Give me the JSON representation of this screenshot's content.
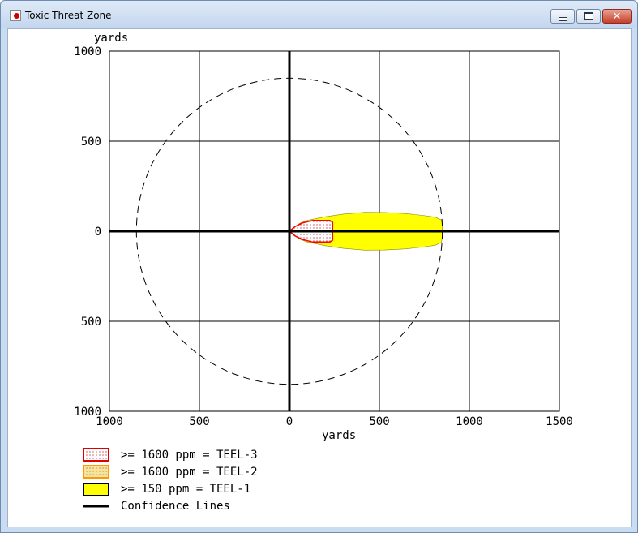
{
  "window": {
    "title": "Toxic Threat Zone",
    "icon": "toxic-zone-app-icon",
    "controls": {
      "minimize_icon": "minimize-icon",
      "maximize_icon": "maximize-icon",
      "close_icon": "close-icon",
      "close_glyph": "✕"
    }
  },
  "chart_data": {
    "type": "threat-zone plot",
    "x": {
      "label": "yards",
      "range": [
        -1000,
        1500
      ],
      "ticks": [
        1000,
        500,
        0,
        500,
        1000,
        1500
      ],
      "tick_values": [
        -1000,
        -500,
        0,
        500,
        1000,
        1500
      ]
    },
    "y": {
      "label": "yards",
      "range": [
        -1000,
        1000
      ],
      "ticks": [
        1000,
        500,
        0,
        500,
        1000
      ],
      "tick_values": [
        1000,
        500,
        0,
        -500,
        -1000
      ]
    },
    "grid": true,
    "confidence_circle_radius": 850,
    "zones": [
      {
        "name": "TEEL-1",
        "color": "#ffff00",
        "outline": [
          [
            0,
            0
          ],
          [
            20,
            -20
          ],
          [
            60,
            -45
          ],
          [
            100,
            -60
          ],
          [
            200,
            -80
          ],
          [
            300,
            -95
          ],
          [
            420,
            -105
          ],
          [
            530,
            -104
          ],
          [
            640,
            -98
          ],
          [
            740,
            -88
          ],
          [
            810,
            -78
          ],
          [
            845,
            -62
          ],
          [
            850,
            -25
          ],
          [
            850,
            25
          ],
          [
            845,
            62
          ],
          [
            810,
            78
          ],
          [
            740,
            88
          ],
          [
            640,
            98
          ],
          [
            530,
            104
          ],
          [
            420,
            105
          ],
          [
            300,
            95
          ],
          [
            200,
            80
          ],
          [
            100,
            60
          ],
          [
            60,
            45
          ],
          [
            20,
            20
          ],
          [
            0,
            0
          ]
        ]
      },
      {
        "name": "TEEL-3",
        "color": "#ff0000",
        "pattern": "dotted",
        "outline": [
          [
            0,
            0
          ],
          [
            30,
            -25
          ],
          [
            70,
            -45
          ],
          [
            130,
            -60
          ],
          [
            225,
            -60
          ],
          [
            240,
            -50
          ],
          [
            240,
            50
          ],
          [
            225,
            60
          ],
          [
            130,
            60
          ],
          [
            70,
            45
          ],
          [
            30,
            25
          ],
          [
            0,
            0
          ]
        ]
      }
    ],
    "legend": [
      {
        "label": ">= 1600 ppm = TEEL-3",
        "swatch": "red-dotted"
      },
      {
        "label": ">= 1600 ppm = TEEL-2",
        "swatch": "orange-dotted"
      },
      {
        "label": ">= 150 ppm = TEEL-1",
        "swatch": "yellow"
      },
      {
        "label": "Confidence Lines",
        "swatch": "black-line"
      }
    ],
    "legend_colors": {
      "teel3": "#e00000",
      "teel2": "#ff9900",
      "teel1": "#ffff00",
      "line": "#000000"
    }
  }
}
